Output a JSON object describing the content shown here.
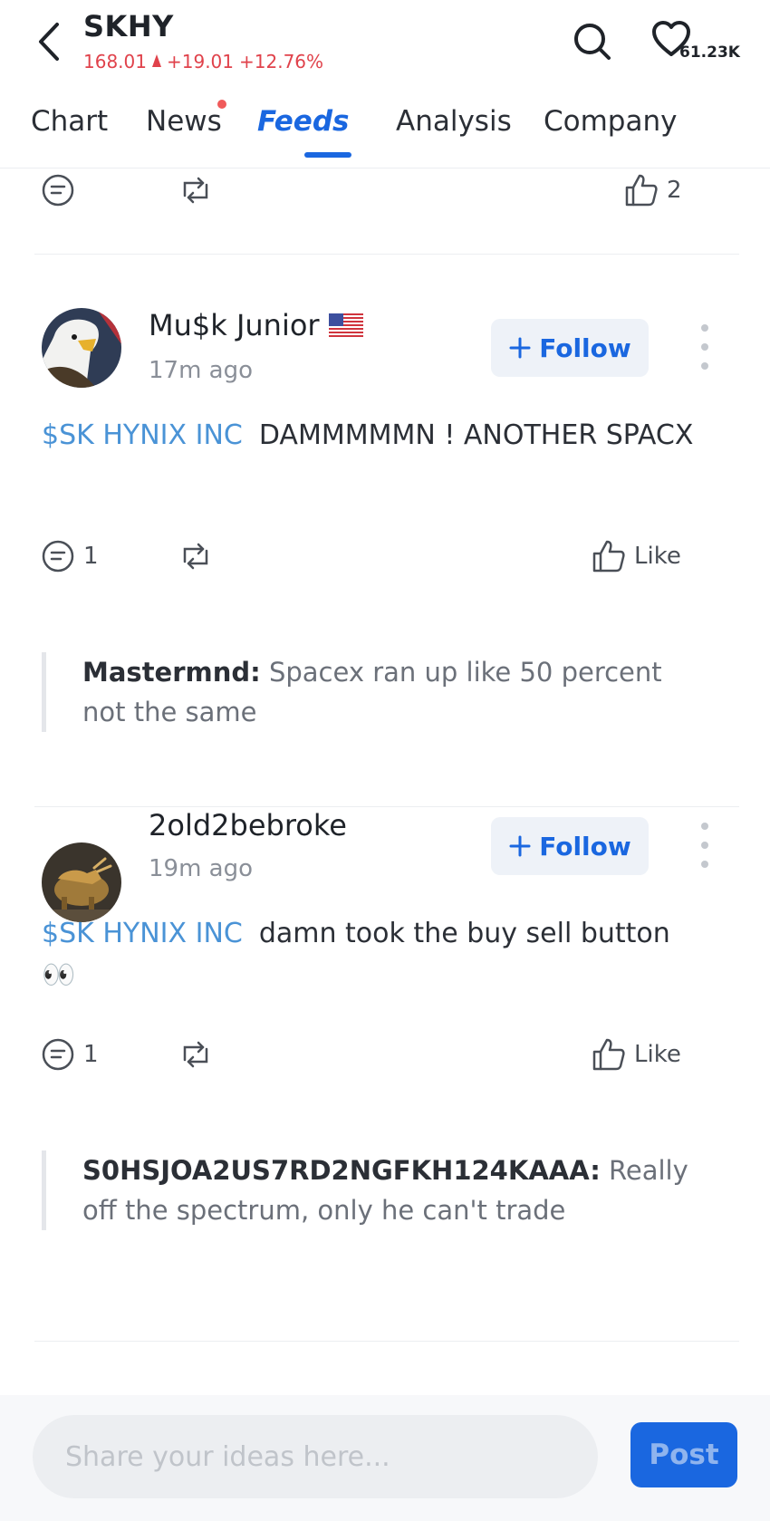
{
  "header": {
    "ticker": "SKHY",
    "price": "168.01",
    "change": "+19.01",
    "change_pct": "+12.76%",
    "watch_count": "61.23K",
    "colors": {
      "down_red": "#e0424b",
      "accent": "#1a67e0"
    }
  },
  "tabs": [
    {
      "label": "Chart",
      "active": false
    },
    {
      "label": "News",
      "active": false,
      "has_dot": true
    },
    {
      "label": "Feeds",
      "active": true
    },
    {
      "label": "Analysis",
      "active": false
    },
    {
      "label": "Company",
      "active": false
    }
  ],
  "prev_post": {
    "like_count": "2"
  },
  "posts": [
    {
      "author": "Mu$k Junior",
      "badge": "us-flag-icon",
      "time": "17m ago",
      "follow_label": "Follow",
      "cashtag": "$SK HYNIX INC",
      "text": "DAMMMMMN ! ANOTHER SPACX",
      "comment_count": "1",
      "like_label": "Like",
      "reply": {
        "user": "Mastermnd:",
        "text": "Spacex ran up like 50 percent not the same"
      }
    },
    {
      "author": "2old2bebroke",
      "time": "19m ago",
      "follow_label": "Follow",
      "cashtag": "$SK HYNIX INC",
      "text": "damn took the buy sell button 👀",
      "comment_count": "1",
      "like_label": "Like",
      "reply": {
        "user": "S0HSJOA2US7RD2NGFKH124KAAA:",
        "text": "Really off the spectrum, only he can't trade"
      }
    }
  ],
  "composer": {
    "placeholder": "Share your ideas here...",
    "post_label": "Post"
  }
}
